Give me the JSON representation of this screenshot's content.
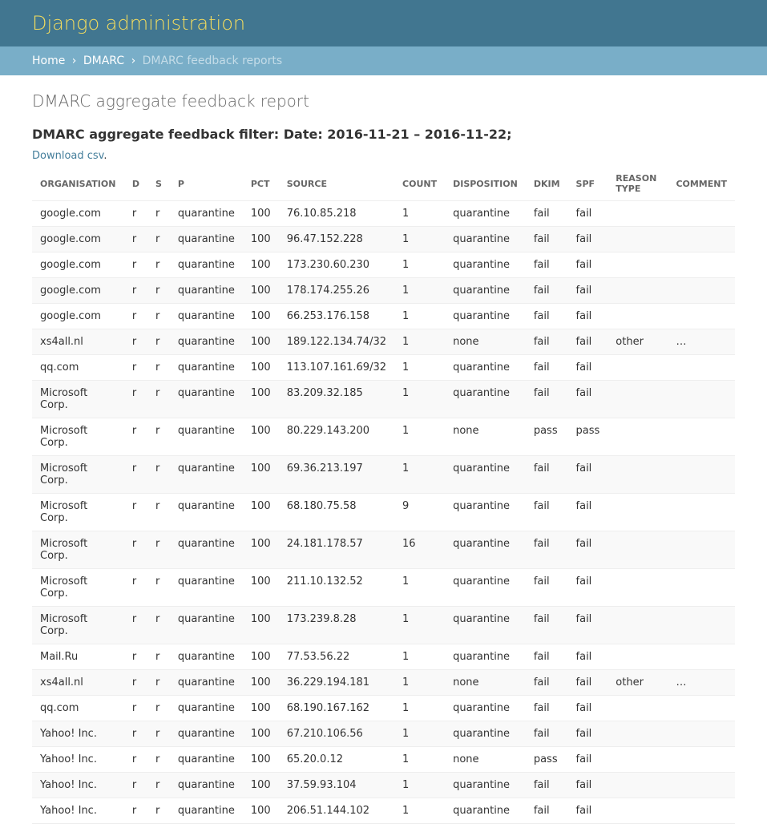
{
  "header": {
    "title": "Django administration"
  },
  "breadcrumbs": {
    "home": "Home",
    "dmarc": "DMARC",
    "current": "DMARC feedback reports"
  },
  "page": {
    "title": "DMARC aggregate feedback report",
    "filter": "DMARC aggregate feedback filter:  Date: 2016-11-21 – 2016-11-22;",
    "download": "Download csv",
    "dot": "."
  },
  "table": {
    "headers": [
      "ORGANISATION",
      "D",
      "S",
      "P",
      "PCT",
      "SOURCE",
      "COUNT",
      "DISPOSITION",
      "DKIM",
      "SPF",
      "REASON TYPE",
      "COMMENT"
    ],
    "rows": [
      [
        "google.com",
        "r",
        "r",
        "quarantine",
        "100",
        "76.10.85.218",
        "1",
        "quarantine",
        "fail",
        "fail",
        "",
        ""
      ],
      [
        "google.com",
        "r",
        "r",
        "quarantine",
        "100",
        "96.47.152.228",
        "1",
        "quarantine",
        "fail",
        "fail",
        "",
        ""
      ],
      [
        "google.com",
        "r",
        "r",
        "quarantine",
        "100",
        "173.230.60.230",
        "1",
        "quarantine",
        "fail",
        "fail",
        "",
        ""
      ],
      [
        "google.com",
        "r",
        "r",
        "quarantine",
        "100",
        "178.174.255.26",
        "1",
        "quarantine",
        "fail",
        "fail",
        "",
        ""
      ],
      [
        "google.com",
        "r",
        "r",
        "quarantine",
        "100",
        "66.253.176.158",
        "1",
        "quarantine",
        "fail",
        "fail",
        "",
        ""
      ],
      [
        "xs4all.nl",
        "r",
        "r",
        "quarantine",
        "100",
        "189.122.134.74/32",
        "1",
        "none",
        "fail",
        "fail",
        "other",
        "…"
      ],
      [
        "qq.com",
        "r",
        "r",
        "quarantine",
        "100",
        "113.107.161.69/32",
        "1",
        "quarantine",
        "fail",
        "fail",
        "",
        ""
      ],
      [
        "Microsoft Corp.",
        "r",
        "r",
        "quarantine",
        "100",
        "83.209.32.185",
        "1",
        "quarantine",
        "fail",
        "fail",
        "",
        ""
      ],
      [
        "Microsoft Corp.",
        "r",
        "r",
        "quarantine",
        "100",
        "80.229.143.200",
        "1",
        "none",
        "pass",
        "pass",
        "",
        ""
      ],
      [
        "Microsoft Corp.",
        "r",
        "r",
        "quarantine",
        "100",
        "69.36.213.197",
        "1",
        "quarantine",
        "fail",
        "fail",
        "",
        ""
      ],
      [
        "Microsoft Corp.",
        "r",
        "r",
        "quarantine",
        "100",
        "68.180.75.58",
        "9",
        "quarantine",
        "fail",
        "fail",
        "",
        ""
      ],
      [
        "Microsoft Corp.",
        "r",
        "r",
        "quarantine",
        "100",
        "24.181.178.57",
        "16",
        "quarantine",
        "fail",
        "fail",
        "",
        ""
      ],
      [
        "Microsoft Corp.",
        "r",
        "r",
        "quarantine",
        "100",
        "211.10.132.52",
        "1",
        "quarantine",
        "fail",
        "fail",
        "",
        ""
      ],
      [
        "Microsoft Corp.",
        "r",
        "r",
        "quarantine",
        "100",
        "173.239.8.28",
        "1",
        "quarantine",
        "fail",
        "fail",
        "",
        ""
      ],
      [
        "Mail.Ru",
        "r",
        "r",
        "quarantine",
        "100",
        "77.53.56.22",
        "1",
        "quarantine",
        "fail",
        "fail",
        "",
        ""
      ],
      [
        "xs4all.nl",
        "r",
        "r",
        "quarantine",
        "100",
        "36.229.194.181",
        "1",
        "none",
        "fail",
        "fail",
        "other",
        "…"
      ],
      [
        "qq.com",
        "r",
        "r",
        "quarantine",
        "100",
        "68.190.167.162",
        "1",
        "quarantine",
        "fail",
        "fail",
        "",
        ""
      ],
      [
        "Yahoo! Inc.",
        "r",
        "r",
        "quarantine",
        "100",
        "67.210.106.56",
        "1",
        "quarantine",
        "fail",
        "fail",
        "",
        ""
      ],
      [
        "Yahoo! Inc.",
        "r",
        "r",
        "quarantine",
        "100",
        "65.20.0.12",
        "1",
        "none",
        "pass",
        "fail",
        "",
        ""
      ],
      [
        "Yahoo! Inc.",
        "r",
        "r",
        "quarantine",
        "100",
        "37.59.93.104",
        "1",
        "quarantine",
        "fail",
        "fail",
        "",
        ""
      ],
      [
        "Yahoo! Inc.",
        "r",
        "r",
        "quarantine",
        "100",
        "206.51.144.102",
        "1",
        "quarantine",
        "fail",
        "fail",
        "",
        ""
      ]
    ]
  }
}
